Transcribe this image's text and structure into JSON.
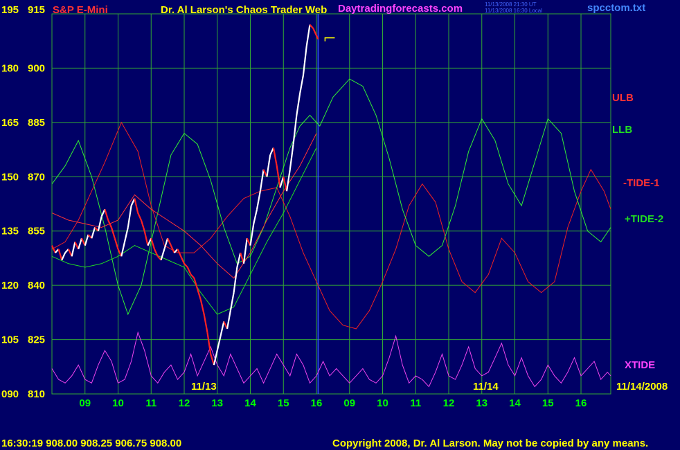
{
  "header": {
    "symbol": "S&P E-Mini",
    "title": "Dr. Al Larson's Chaos Trader Web",
    "site": "Daytradingforecasts.com",
    "stamp_ut": "11/13/2008 21:30 UT",
    "stamp_local": "11/13/2008 16:30 Local",
    "file": "spcctom.txt"
  },
  "footer": {
    "quote": "16:30:19  908.00  908.25  906.75  908.00",
    "copyright": "Copyright 2008, Dr. Al Larson. May not be copied by any means."
  },
  "colors": {
    "background": "#000066",
    "grid": "#33aa33",
    "price_up": "#ffffff",
    "price_down": "#ff2222",
    "ulb": "#ff3333",
    "llb": "#22dd22",
    "tide1": "#ee2222",
    "tide2": "#33ee33",
    "xtide": "#ee44ee",
    "axis_left": "#ffff00",
    "axis_bottom": "#00ff00",
    "date_labels": "#ffff00",
    "symbol": "#ff3333",
    "title": "#ffff00",
    "site": "#ff44ff",
    "file": "#4488ff",
    "stamp": "#4466ff"
  },
  "chart_data": {
    "type": "line",
    "ylim_price": [
      810,
      915
    ],
    "ylim_secondary": [
      90,
      195
    ],
    "y_ticks": [
      {
        "price": "915",
        "secondary": "195"
      },
      {
        "price": "900",
        "secondary": "180"
      },
      {
        "price": "885",
        "secondary": "165"
      },
      {
        "price": "870",
        "secondary": "150"
      },
      {
        "price": "855",
        "secondary": "135"
      },
      {
        "price": "840",
        "secondary": "120"
      },
      {
        "price": "825",
        "secondary": "105"
      },
      {
        "price": "810",
        "secondary": "090"
      }
    ],
    "x_ticks": [
      "09",
      "10",
      "11",
      "12",
      "13",
      "14",
      "15",
      "16",
      "09",
      "10",
      "11",
      "12",
      "13",
      "14",
      "15",
      "16"
    ],
    "date_labels": [
      "11/13",
      "11/14",
      "11/14/2008"
    ],
    "series_labels": [
      {
        "name": "ULB",
        "color": "#ff3333"
      },
      {
        "name": "LLB",
        "color": "#22dd22"
      },
      {
        "name": "-TIDE-1",
        "color": "#ff3333"
      },
      {
        "name": "+TIDE-2",
        "color": "#22dd22"
      },
      {
        "name": "XTIDE",
        "color": "#ff44ff"
      }
    ],
    "price_series": [
      [
        8.0,
        851
      ],
      [
        8.1,
        849
      ],
      [
        8.2,
        850
      ],
      [
        8.3,
        847
      ],
      [
        8.4,
        849
      ],
      [
        8.5,
        850
      ],
      [
        8.6,
        848
      ],
      [
        8.7,
        852
      ],
      [
        8.8,
        850
      ],
      [
        8.9,
        853
      ],
      [
        9.0,
        851
      ],
      [
        9.1,
        854
      ],
      [
        9.2,
        853
      ],
      [
        9.3,
        856
      ],
      [
        9.4,
        855
      ],
      [
        9.5,
        859
      ],
      [
        9.6,
        861
      ],
      [
        9.7,
        858
      ],
      [
        9.8,
        856
      ],
      [
        9.9,
        853
      ],
      [
        10.0,
        850
      ],
      [
        10.1,
        848
      ],
      [
        10.2,
        852
      ],
      [
        10.3,
        856
      ],
      [
        10.4,
        862
      ],
      [
        10.5,
        864
      ],
      [
        10.6,
        860
      ],
      [
        10.7,
        858
      ],
      [
        10.8,
        855
      ],
      [
        10.9,
        851
      ],
      [
        11.0,
        853
      ],
      [
        11.1,
        850
      ],
      [
        11.2,
        848
      ],
      [
        11.3,
        847
      ],
      [
        11.4,
        850
      ],
      [
        11.5,
        853
      ],
      [
        11.6,
        851
      ],
      [
        11.7,
        849
      ],
      [
        11.8,
        850
      ],
      [
        11.9,
        848
      ],
      [
        12.0,
        846
      ],
      [
        12.1,
        845
      ],
      [
        12.2,
        843
      ],
      [
        12.3,
        842
      ],
      [
        12.4,
        839
      ],
      [
        12.5,
        836
      ],
      [
        12.6,
        832
      ],
      [
        12.7,
        827
      ],
      [
        12.8,
        821
      ],
      [
        12.9,
        818
      ],
      [
        13.0,
        822
      ],
      [
        13.1,
        826
      ],
      [
        13.2,
        830
      ],
      [
        13.3,
        828
      ],
      [
        13.4,
        833
      ],
      [
        13.5,
        838
      ],
      [
        13.6,
        845
      ],
      [
        13.7,
        849
      ],
      [
        13.8,
        846
      ],
      [
        13.9,
        853
      ],
      [
        14.0,
        851
      ],
      [
        14.1,
        857
      ],
      [
        14.2,
        861
      ],
      [
        14.3,
        866
      ],
      [
        14.4,
        872
      ],
      [
        14.5,
        870
      ],
      [
        14.6,
        876
      ],
      [
        14.7,
        878
      ],
      [
        14.8,
        873
      ],
      [
        14.9,
        867
      ],
      [
        15.0,
        870
      ],
      [
        15.1,
        866
      ],
      [
        15.2,
        872
      ],
      [
        15.3,
        879
      ],
      [
        15.4,
        887
      ],
      [
        15.5,
        893
      ],
      [
        15.6,
        898
      ],
      [
        15.7,
        906
      ],
      [
        15.8,
        912
      ],
      [
        15.9,
        911
      ],
      [
        16.0,
        909
      ],
      [
        16.05,
        908
      ]
    ],
    "ulb_series": [
      [
        8.0,
        860
      ],
      [
        8.5,
        858
      ],
      [
        9.0,
        857
      ],
      [
        9.5,
        856
      ],
      [
        10.0,
        858
      ],
      [
        10.5,
        865
      ],
      [
        11.0,
        861
      ],
      [
        11.5,
        858
      ],
      [
        12.0,
        855
      ],
      [
        12.5,
        851
      ],
      [
        13.0,
        846
      ],
      [
        13.5,
        842
      ],
      [
        14.0,
        849
      ],
      [
        14.5,
        858
      ],
      [
        15.0,
        866
      ],
      [
        15.5,
        873
      ],
      [
        16.0,
        882
      ]
    ],
    "llb_series": [
      [
        8.0,
        848
      ],
      [
        8.5,
        846
      ],
      [
        9.0,
        845
      ],
      [
        9.5,
        846
      ],
      [
        10.0,
        848
      ],
      [
        10.5,
        851
      ],
      [
        11.0,
        849
      ],
      [
        11.5,
        847
      ],
      [
        12.0,
        845
      ],
      [
        12.5,
        838
      ],
      [
        13.0,
        832
      ],
      [
        13.5,
        834
      ],
      [
        14.0,
        843
      ],
      [
        14.5,
        852
      ],
      [
        15.0,
        860
      ],
      [
        15.5,
        869
      ],
      [
        16.0,
        878
      ]
    ],
    "tide1_series": [
      [
        8.0,
        850
      ],
      [
        8.4,
        852
      ],
      [
        8.8,
        858
      ],
      [
        9.2,
        866
      ],
      [
        9.6,
        874
      ],
      [
        10.1,
        885
      ],
      [
        10.6,
        877
      ],
      [
        11.0,
        862
      ],
      [
        11.4,
        851
      ],
      [
        11.8,
        849
      ],
      [
        12.3,
        849
      ],
      [
        12.8,
        853
      ],
      [
        13.3,
        859
      ],
      [
        13.8,
        864
      ],
      [
        14.3,
        866
      ],
      [
        14.8,
        867
      ],
      [
        15.2,
        859
      ],
      [
        15.6,
        849
      ],
      [
        16.0,
        841
      ],
      [
        16.4,
        833
      ],
      [
        16.8,
        829
      ],
      [
        17.2,
        828
      ],
      [
        17.6,
        833
      ],
      [
        18.0,
        841
      ],
      [
        18.4,
        850
      ],
      [
        18.8,
        862
      ],
      [
        19.2,
        868
      ],
      [
        19.6,
        863
      ],
      [
        20.0,
        850
      ],
      [
        20.4,
        841
      ],
      [
        20.8,
        838
      ],
      [
        21.2,
        843
      ],
      [
        21.6,
        853
      ],
      [
        22.0,
        849
      ],
      [
        22.4,
        841
      ],
      [
        22.8,
        838
      ],
      [
        23.2,
        841
      ],
      [
        23.6,
        856
      ],
      [
        24.0,
        866
      ],
      [
        24.3,
        872
      ],
      [
        24.7,
        866
      ],
      [
        24.9,
        861
      ]
    ],
    "tide2_series": [
      [
        8.0,
        868
      ],
      [
        8.4,
        873
      ],
      [
        8.8,
        880
      ],
      [
        9.2,
        870
      ],
      [
        9.6,
        856
      ],
      [
        10.0,
        840
      ],
      [
        10.3,
        832
      ],
      [
        10.7,
        840
      ],
      [
        11.2,
        860
      ],
      [
        11.6,
        876
      ],
      [
        12.0,
        882
      ],
      [
        12.4,
        879
      ],
      [
        12.8,
        869
      ],
      [
        13.2,
        856
      ],
      [
        13.6,
        846
      ],
      [
        14.0,
        848
      ],
      [
        14.4,
        856
      ],
      [
        14.8,
        867
      ],
      [
        15.2,
        878
      ],
      [
        15.5,
        884
      ],
      [
        15.8,
        887
      ],
      [
        16.1,
        884
      ],
      [
        16.5,
        892
      ],
      [
        17.0,
        897
      ],
      [
        17.4,
        895
      ],
      [
        17.8,
        887
      ],
      [
        18.2,
        875
      ],
      [
        18.6,
        861
      ],
      [
        19.0,
        851
      ],
      [
        19.4,
        848
      ],
      [
        19.8,
        851
      ],
      [
        20.2,
        862
      ],
      [
        20.6,
        877
      ],
      [
        21.0,
        886
      ],
      [
        21.4,
        880
      ],
      [
        21.8,
        868
      ],
      [
        22.2,
        862
      ],
      [
        22.6,
        874
      ],
      [
        23.0,
        886
      ],
      [
        23.4,
        882
      ],
      [
        23.8,
        866
      ],
      [
        24.2,
        855
      ],
      [
        24.6,
        852
      ],
      [
        24.9,
        856
      ]
    ],
    "xtide_series": [
      [
        8.0,
        817
      ],
      [
        8.2,
        814
      ],
      [
        8.4,
        813
      ],
      [
        8.6,
        815
      ],
      [
        8.8,
        818
      ],
      [
        9.0,
        814
      ],
      [
        9.2,
        813
      ],
      [
        9.4,
        818
      ],
      [
        9.6,
        822
      ],
      [
        9.8,
        819
      ],
      [
        10.0,
        813
      ],
      [
        10.2,
        814
      ],
      [
        10.4,
        819
      ],
      [
        10.6,
        827
      ],
      [
        10.8,
        822
      ],
      [
        11.0,
        815
      ],
      [
        11.2,
        813
      ],
      [
        11.4,
        816
      ],
      [
        11.6,
        818
      ],
      [
        11.8,
        814
      ],
      [
        12.0,
        816
      ],
      [
        12.2,
        821
      ],
      [
        12.4,
        815
      ],
      [
        12.6,
        819
      ],
      [
        12.8,
        823
      ],
      [
        13.0,
        818
      ],
      [
        13.2,
        815
      ],
      [
        13.4,
        821
      ],
      [
        13.6,
        817
      ],
      [
        13.8,
        813
      ],
      [
        14.0,
        815
      ],
      [
        14.2,
        817
      ],
      [
        14.4,
        813
      ],
      [
        14.6,
        817
      ],
      [
        14.8,
        821
      ],
      [
        15.0,
        818
      ],
      [
        15.2,
        815
      ],
      [
        15.4,
        821
      ],
      [
        15.6,
        818
      ],
      [
        15.8,
        813
      ],
      [
        16.0,
        815
      ],
      [
        16.2,
        819
      ],
      [
        16.4,
        815
      ],
      [
        16.6,
        817
      ],
      [
        16.8,
        815
      ],
      [
        17.0,
        813
      ],
      [
        17.2,
        815
      ],
      [
        17.4,
        817
      ],
      [
        17.6,
        814
      ],
      [
        17.8,
        813
      ],
      [
        18.0,
        815
      ],
      [
        18.2,
        820
      ],
      [
        18.4,
        826
      ],
      [
        18.6,
        818
      ],
      [
        18.8,
        813
      ],
      [
        19.0,
        815
      ],
      [
        19.2,
        814
      ],
      [
        19.4,
        812
      ],
      [
        19.6,
        816
      ],
      [
        19.8,
        821
      ],
      [
        20.0,
        815
      ],
      [
        20.2,
        814
      ],
      [
        20.4,
        818
      ],
      [
        20.6,
        823
      ],
      [
        20.8,
        817
      ],
      [
        21.0,
        815
      ],
      [
        21.2,
        816
      ],
      [
        21.4,
        820
      ],
      [
        21.6,
        824
      ],
      [
        21.8,
        818
      ],
      [
        22.0,
        815
      ],
      [
        22.2,
        820
      ],
      [
        22.4,
        815
      ],
      [
        22.6,
        812
      ],
      [
        22.8,
        814
      ],
      [
        23.0,
        818
      ],
      [
        23.2,
        815
      ],
      [
        23.4,
        813
      ],
      [
        23.6,
        816
      ],
      [
        23.8,
        820
      ],
      [
        24.0,
        815
      ],
      [
        24.2,
        817
      ],
      [
        24.4,
        819
      ],
      [
        24.6,
        814
      ],
      [
        24.8,
        816
      ],
      [
        24.9,
        815
      ]
    ]
  }
}
